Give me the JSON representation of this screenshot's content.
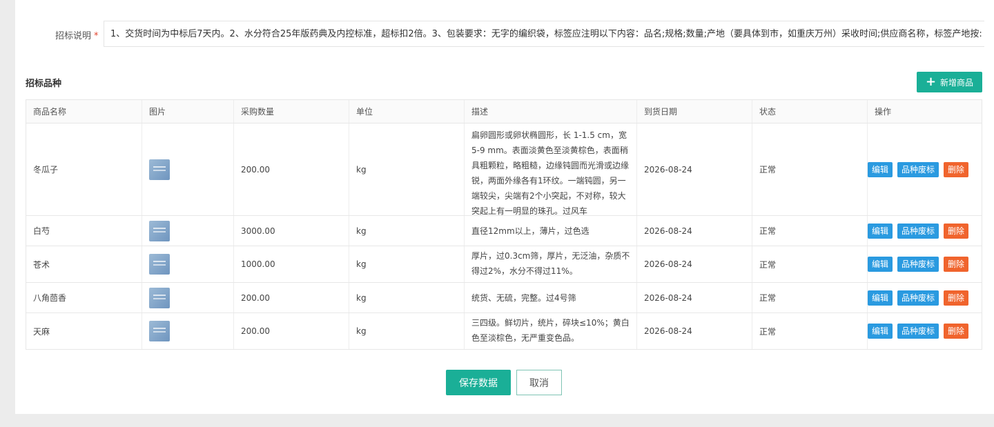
{
  "tender_note": {
    "label": "招标说明",
    "required_mark": "*",
    "value": "1、交货时间为中标后7天内。2、水分符合25年版药典及内控标准，超标扣2倍。3、包装要求：无字的编织袋，标签应注明以下内容：品名;规格;数量;产地（要具体到市，如重庆万州）采收时间;供应商名称，标签产地按:"
  },
  "section": {
    "title": "招标品种",
    "add_button_label": "新增商品"
  },
  "table": {
    "headers": [
      "商品名称",
      "图片",
      "采购数量",
      "单位",
      "描述",
      "到货日期",
      "状态",
      "操作"
    ],
    "rows": [
      {
        "name": "冬瓜子",
        "qty": "200.00",
        "unit": "kg",
        "desc": "扁卵圆形或卵状椭圆形，长 1-1.5 cm，宽 5-9 mm。表面淡黄色至淡黄棕色，表面稍具粗颗粒，略粗糙，边缘钝圆而光滑或边缘锐，两面外缘各有1环纹。一端钝圆，另一端较尖，尖端有2个小突起，不对称，较大突起上有一明显的珠孔。过风车",
        "date": "2026-08-24",
        "status": "正常"
      },
      {
        "name": "白芍",
        "qty": "3000.00",
        "unit": "kg",
        "desc": "直径12mm以上，薄片，过色选",
        "date": "2026-08-24",
        "status": "正常"
      },
      {
        "name": "苍术",
        "qty": "1000.00",
        "unit": "kg",
        "desc": "厚片，过0.3cm筛，厚片，无泛油，杂质不得过2%，水分不得过11%。",
        "date": "2026-08-24",
        "status": "正常"
      },
      {
        "name": "八角茴香",
        "qty": "200.00",
        "unit": "kg",
        "desc": "统货、无硫，完整。过4号筛",
        "date": "2026-08-24",
        "status": "正常"
      },
      {
        "name": "天麻",
        "qty": "200.00",
        "unit": "kg",
        "desc": "三四级。鲜切片，统片，碎块≤10%；黄白色至淡棕色，无严重变色品。",
        "date": "2026-08-24",
        "status": "正常"
      }
    ],
    "actions": {
      "edit": "编辑",
      "void": "品种废标",
      "delete": "删除"
    }
  },
  "footer": {
    "save_label": "保存数据",
    "cancel_label": "取消"
  }
}
